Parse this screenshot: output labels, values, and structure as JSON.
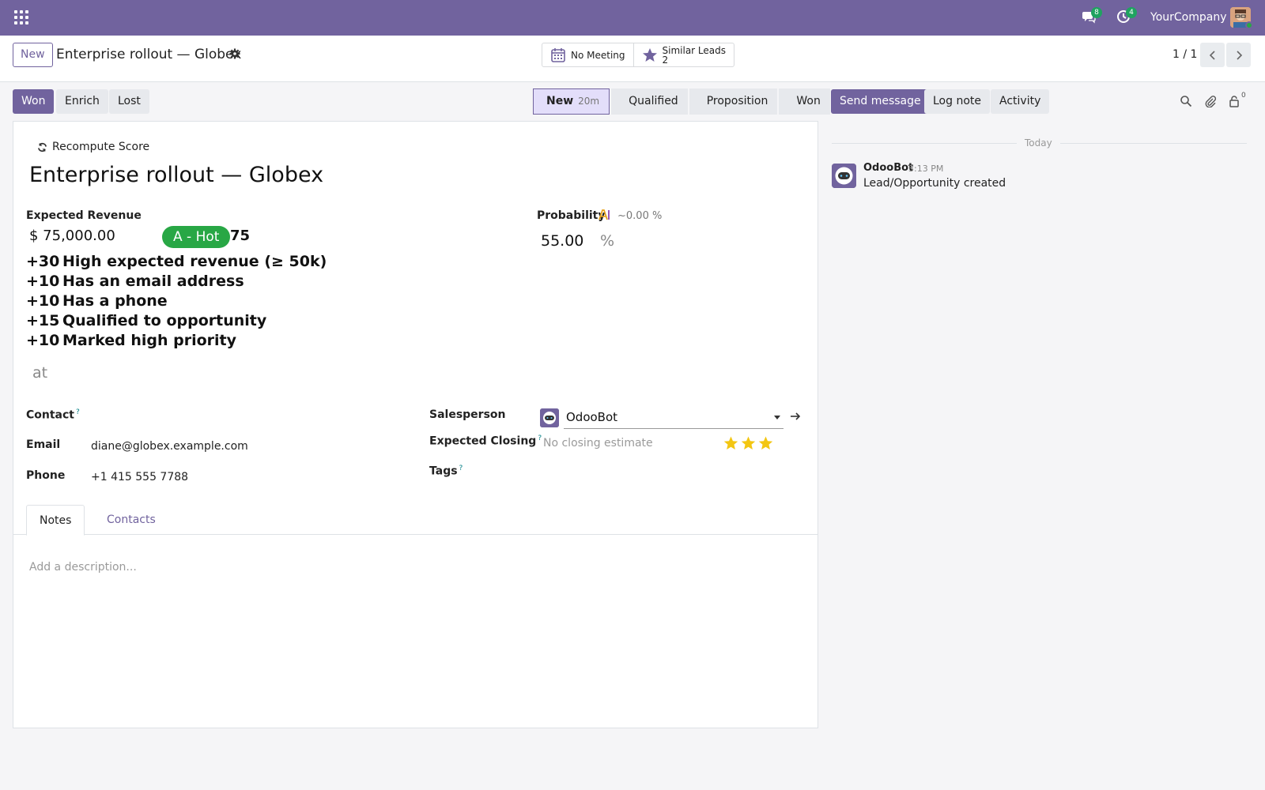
{
  "navbar": {
    "messages_count": "8",
    "activities_count": "4",
    "company": "YourCompany"
  },
  "control": {
    "new_label": "New",
    "record_title": "Enterprise rollout — Globex",
    "smart_buttons": {
      "meeting": "No Meeting",
      "similar_label": "Similar Leads",
      "similar_count": "2"
    },
    "pager": "1 / 1"
  },
  "statusbar": {
    "buttons": [
      "Won",
      "Enrich",
      "Lost"
    ],
    "stages": [
      {
        "label": "New",
        "ago": "20m",
        "current": true
      },
      {
        "label": "Qualified"
      },
      {
        "label": "Proposition"
      },
      {
        "label": "Won"
      }
    ]
  },
  "form": {
    "recompute_label": "Recompute Score",
    "name": "Enterprise rollout — Globex",
    "expected_revenue_label": "Expected Revenue",
    "expected_revenue": "$ 75,000.00",
    "score_badge": "A - Hot",
    "score_value": "75",
    "score_reasons": [
      {
        "points": "+30",
        "text": "High expected revenue (≥ 50k)"
      },
      {
        "points": "+10",
        "text": "Has an email address"
      },
      {
        "points": "+10",
        "text": "Has a phone"
      },
      {
        "points": "+15",
        "text": "Qualified to opportunity"
      },
      {
        "points": "+10",
        "text": "Marked high priority"
      }
    ],
    "stray_text": "at",
    "probability_label": "Probability",
    "ai_probability": "~0.00 %",
    "probability": "55.00",
    "probability_unit": "%",
    "contact_label": "Contact",
    "email_label": "Email",
    "email": "diane@globex.example.com",
    "phone_label": "Phone",
    "phone": "+1 415 555 7788",
    "salesperson_label": "Salesperson",
    "salesperson": "OdooBot",
    "expected_closing_label": "Expected Closing",
    "expected_closing_placeholder": "No closing estimate",
    "priority_stars": 3,
    "tags_label": "Tags",
    "help_mark": "?",
    "tabs": [
      "Notes",
      "Contacts"
    ],
    "description_placeholder": "Add a description..."
  },
  "chatter": {
    "send_message": "Send message",
    "log_note": "Log note",
    "activity": "Activity",
    "followers_count": "0",
    "date_separator": "Today",
    "messages": [
      {
        "author": "OdooBot",
        "time": "3:13 PM",
        "body": "Lead/Opportunity created"
      }
    ]
  },
  "colors": {
    "brand": "#71639e",
    "hot": "#28a745",
    "star": "#f3c612"
  }
}
